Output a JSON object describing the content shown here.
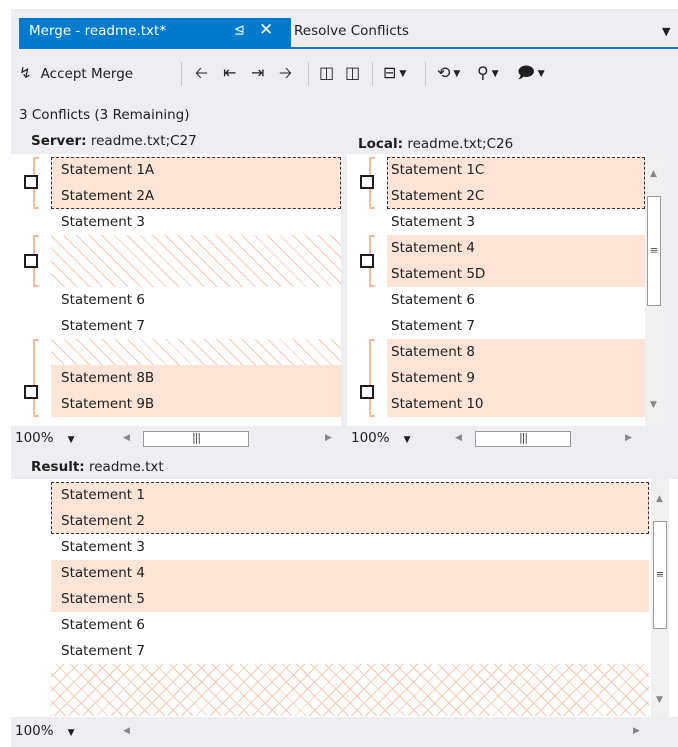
{
  "tabs": {
    "active_label": "Merge - readme.txt*",
    "pin_icon": "pin-icon",
    "close_icon": "close-icon",
    "inactive_label": "Resolve Conflicts",
    "dropdown_icon": "chevron-down-icon"
  },
  "toolbar": {
    "accept_merge_label": "Accept Merge",
    "icons": {
      "accept": "accept-merge-icon",
      "prev_conflict": "previous-conflict-icon",
      "first_conflict": "first-conflict-icon",
      "last_conflict": "last-conflict-icon",
      "next_conflict": "next-conflict-icon",
      "layout_left": "layout-left-icon",
      "layout_right": "layout-right-icon",
      "layout_split": "layout-split-icon",
      "history": "history-icon",
      "compare": "compare-icon",
      "comment": "comment-icon"
    }
  },
  "summary": "3 Conflicts (3 Remaining)",
  "server": {
    "head_bold": "Server:",
    "head_rest": "readme.txt;C27",
    "lines": [
      "Statement 1A",
      "Statement 2A",
      "Statement 3",
      "Statement 6",
      "Statement 7",
      "Statement 8B",
      "Statement 9B"
    ],
    "zoom": "100%"
  },
  "local": {
    "head_bold": "Local:",
    "head_rest": "readme.txt;C26",
    "lines": [
      "Statement 1C",
      "Statement 2C",
      "Statement 3",
      "Statement 4",
      "Statement 5D",
      "Statement 6",
      "Statement 7",
      "Statement 8",
      "Statement 9",
      "Statement 10"
    ],
    "zoom": "100%"
  },
  "result": {
    "head_bold": "Result:",
    "head_rest": "readme.txt",
    "lines": [
      "Statement 1",
      "Statement 2",
      "Statement 3",
      "Statement 4",
      "Statement 5",
      "Statement 6",
      "Statement 7"
    ],
    "zoom": "100%"
  },
  "colors": {
    "accent": "#007acc",
    "conflict_bg": "#fce5d7",
    "hatch": "#f5c9b4",
    "chrome_bg": "#eeeef2"
  }
}
